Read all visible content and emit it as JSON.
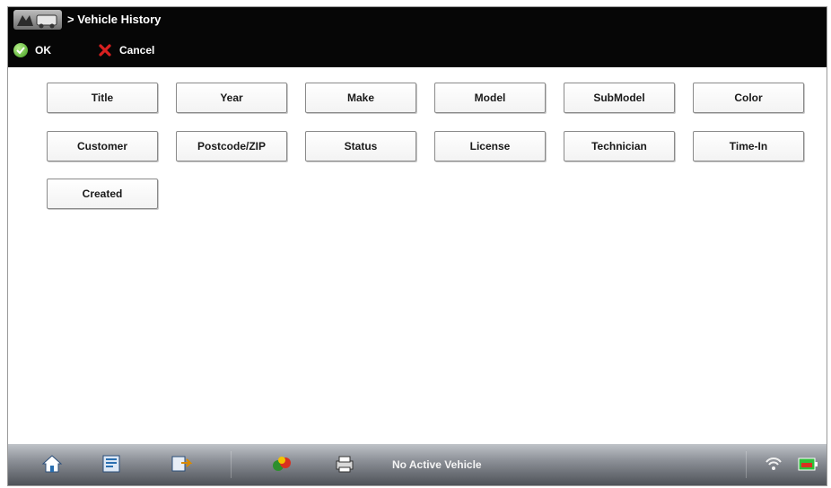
{
  "header": {
    "breadcrumb": "> Vehicle History",
    "ok_label": "OK",
    "cancel_label": "Cancel"
  },
  "fields": [
    "Title",
    "Year",
    "Make",
    "Model",
    "SubModel",
    "Color",
    "Customer",
    "Postcode/ZIP",
    "Status",
    "License",
    "Technician",
    "Time-In",
    "Created"
  ],
  "toolbar": {
    "status_text": "No Active Vehicle",
    "icons": [
      "home-icon",
      "vehicle-record-icon",
      "tools-icon",
      "system-icon",
      "printer-icon",
      "wireless-icon",
      "battery-icon"
    ]
  },
  "colors": {
    "header_bg": "#060606",
    "ok_green": "#3e9a1c",
    "cancel_red": "#d92020"
  }
}
